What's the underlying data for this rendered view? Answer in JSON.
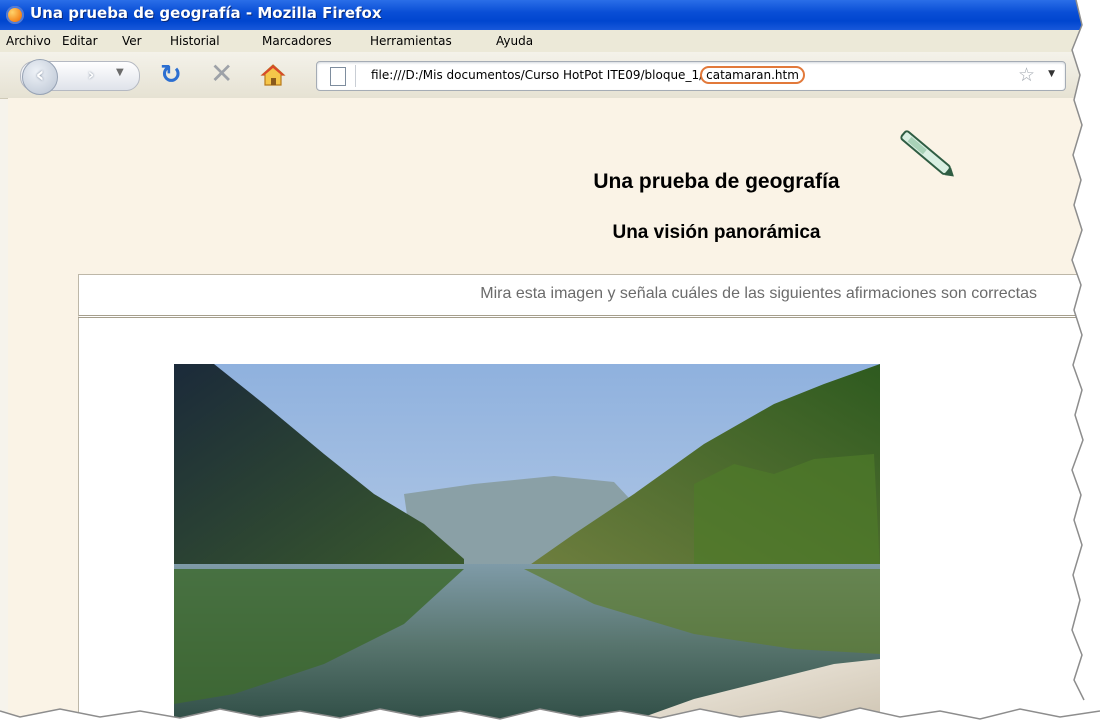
{
  "window": {
    "title": "Una prueba de geografía - Mozilla Firefox"
  },
  "menu": {
    "items": [
      "Archivo",
      "Editar",
      "Ver",
      "Historial",
      "Marcadores",
      "Herramientas",
      "Ayuda"
    ]
  },
  "toolbar": {
    "back_icon": "back-arrow-icon",
    "forward_icon": "forward-arrow-icon",
    "reload_icon": "reload-icon",
    "stop_icon": "stop-x-icon",
    "home_icon": "home-icon"
  },
  "address_bar": {
    "url_base": "file:///D:/Mis documentos/Curso HotPot ITE09/bloque_1/",
    "url_file": "catamaran.htm",
    "highlight_color": "#e2793a"
  },
  "page": {
    "title": "Una prueba de geografía",
    "subtitle": "Una visión panorámica",
    "instruction": "Mira esta imagen y señala cuáles de las siguientes afirmaciones son correctas"
  },
  "colors": {
    "titlebar": "#0046cf",
    "page_bg": "#faf3e6",
    "instruction_text": "#6b6b6b"
  }
}
